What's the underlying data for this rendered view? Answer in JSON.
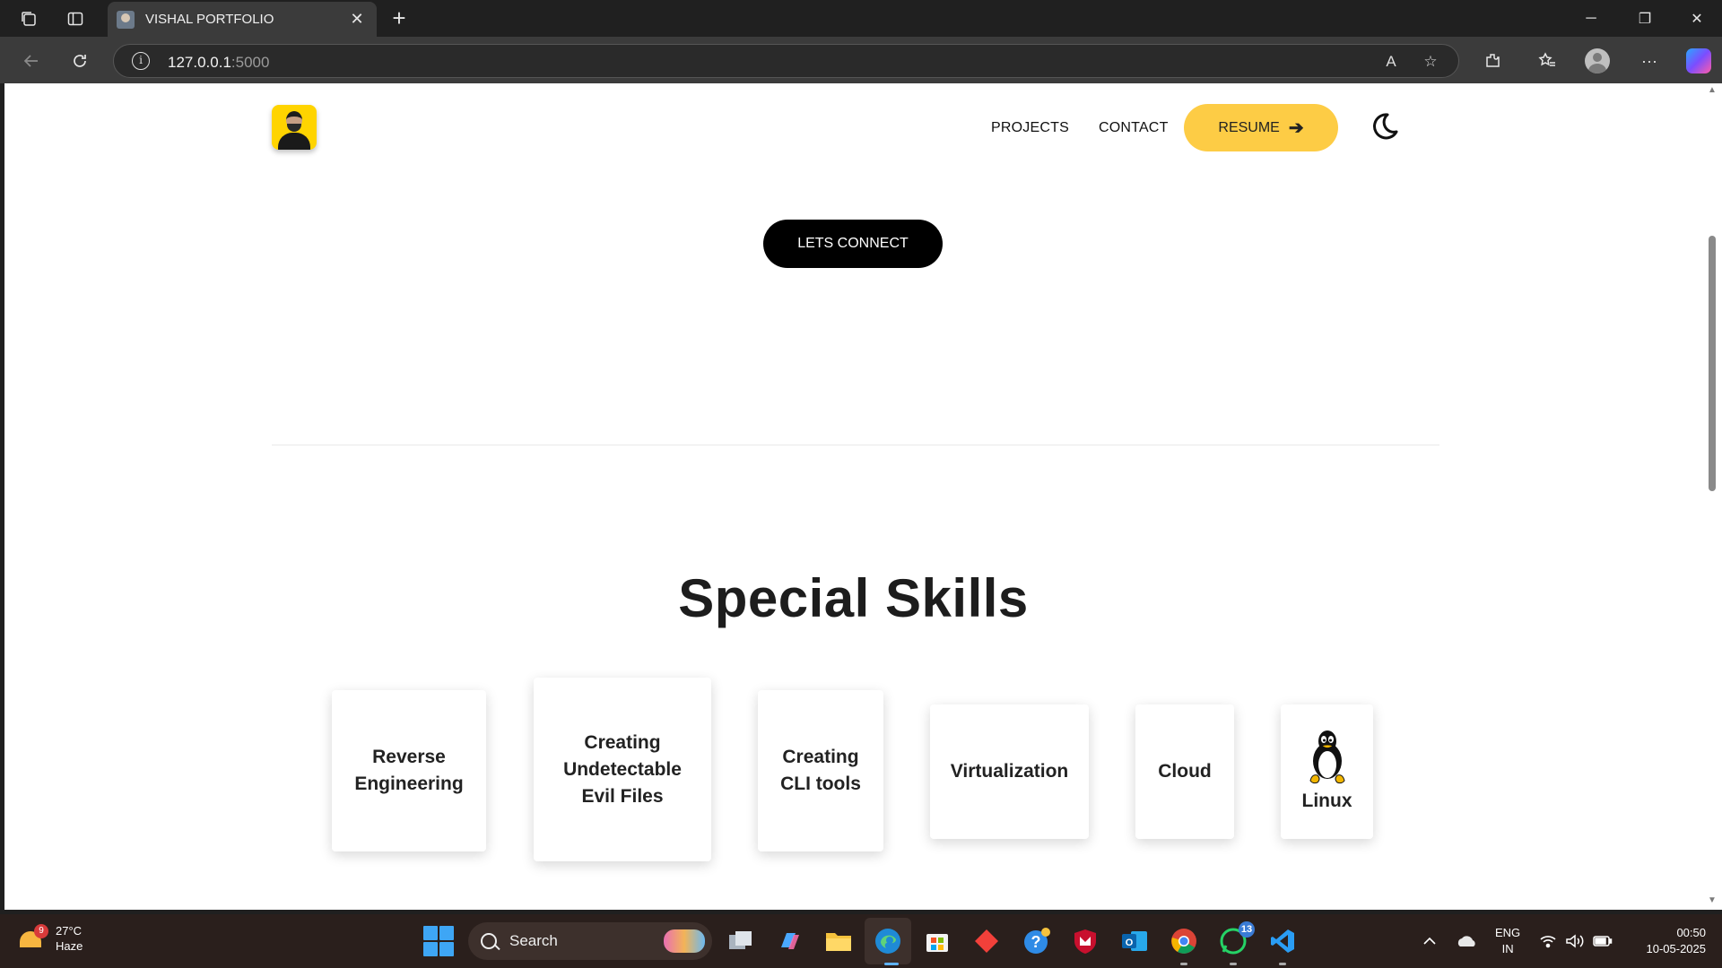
{
  "browser": {
    "tab_title": "VISHAL PORTFOLIO",
    "tab_close": "✕",
    "new_tab": "+",
    "url_host": "127.0.0.1",
    "url_port": ":5000",
    "window_controls": {
      "minimize": "─",
      "maximize": "❐",
      "close": "✕"
    }
  },
  "site": {
    "nav": {
      "projects": "PROJECTS",
      "contact": "CONTACT",
      "resume": "RESUME",
      "resume_arrow": "➔"
    },
    "connect_button": "LETS CONNECT",
    "skills_title": "Special Skills",
    "skills": [
      {
        "label_lines": [
          "Reverse",
          "Engineering"
        ],
        "icon": null
      },
      {
        "label_lines": [
          "Creating",
          "Undetectable",
          "Evil Files"
        ],
        "icon": null
      },
      {
        "label_lines": [
          "Creating",
          "CLI tools"
        ],
        "icon": null
      },
      {
        "label_lines": [
          "Virtualization"
        ],
        "icon": null
      },
      {
        "label_lines": [
          "Cloud"
        ],
        "icon": null
      },
      {
        "label_lines": [
          "Linux"
        ],
        "icon": "linux-tux-icon"
      }
    ]
  },
  "taskbar": {
    "weather": {
      "badge": "9",
      "temp": "27°C",
      "condition": "Haze"
    },
    "search_label": "Search",
    "apps": [
      {
        "name": "task-view",
        "icon": "task-view-icon"
      },
      {
        "name": "copilot",
        "icon": "copilot-icon"
      },
      {
        "name": "file-explorer",
        "icon": "folder-icon"
      },
      {
        "name": "edge",
        "icon": "edge-icon"
      },
      {
        "name": "microsoft-store",
        "icon": "store-icon"
      },
      {
        "name": "app-red-diamond",
        "icon": "diamond-icon"
      },
      {
        "name": "help",
        "icon": "help-icon",
        "label": "?"
      },
      {
        "name": "mcafee",
        "icon": "shield-icon"
      },
      {
        "name": "outlook",
        "icon": "outlook-icon",
        "label": "O"
      },
      {
        "name": "chrome",
        "icon": "chrome-icon"
      },
      {
        "name": "whatsapp",
        "icon": "whatsapp-icon",
        "badge": "13"
      },
      {
        "name": "vscode",
        "icon": "vscode-icon"
      }
    ],
    "tray": {
      "lang_top": "ENG",
      "lang_bottom": "IN",
      "time": "00:50",
      "date": "10-05-2025"
    }
  },
  "colors": {
    "resume_bg": "#fdcc45",
    "connect_bg": "#000000",
    "logo_bg": "#ffd400"
  }
}
